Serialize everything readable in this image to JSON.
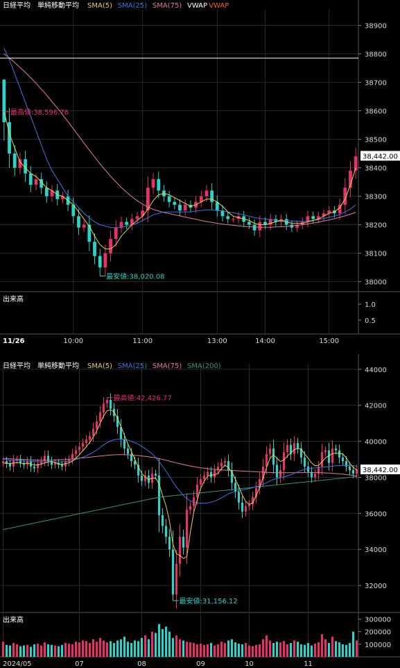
{
  "colors": {
    "background": "#000000",
    "grid": "#2a2a2a",
    "axis_text": "#d8d8d8",
    "up": "#e8306a",
    "down": "#2ad4c8",
    "sma5": "#e8d24a",
    "sma25": "#3a78e0",
    "sma75": "#e87aa0",
    "sma200": "#2a9a70",
    "vwap_white": "#ffffff",
    "vwap_orange": "#f0622a",
    "high_label": "#e8306a",
    "low_label": "#2ad4c8",
    "price_box": "#ffffff"
  },
  "top": {
    "title": "日経平均",
    "legend_label": "単純移動平均",
    "legend": [
      {
        "name": "SMA(5)",
        "color": "#e8d24a"
      },
      {
        "name": "SMA(25)",
        "color": "#3a78e0"
      },
      {
        "name": "SMA(75)",
        "color": "#e87aa0"
      },
      {
        "name": "VWAP",
        "color": "#ffffff"
      },
      {
        "name": "VWAP",
        "color": "#f0622a"
      }
    ],
    "high_label": "最高値:38,596.76",
    "low_label": "最安値:38,020.08",
    "current_price": "38,442.00",
    "volume_title": "出来高",
    "date_label": "11/26"
  },
  "bottom": {
    "title": "日経平均",
    "legend_label": "単純移動平均",
    "legend": [
      {
        "name": "SMA(5)",
        "color": "#e8d24a"
      },
      {
        "name": "SMA(25)",
        "color": "#3a78e0"
      },
      {
        "name": "SMA(75)",
        "color": "#e87aa0"
      },
      {
        "name": "SMA(200)",
        "color": "#2a9a70"
      }
    ],
    "high_label": "最高値:42,426.77",
    "low_label": "最安値:31,156.12",
    "current_price": "38,442.00",
    "volume_title": "出来高"
  },
  "chart_data": [
    {
      "type": "candlestick",
      "title": "日経平均",
      "period": "intraday 5-min",
      "x_ticks": [
        "10:00",
        "11:00",
        "13:00",
        "14:00",
        "15:00"
      ],
      "y_ticks": [
        38000,
        38100,
        38200,
        38300,
        38400,
        38500,
        38600,
        38700,
        38800,
        38900
      ],
      "ylim": [
        37965,
        38955
      ],
      "high": 38596.76,
      "low": 38020.08,
      "last": 38442.0,
      "vwap_level": 38785,
      "closes": [
        38560,
        38450,
        38400,
        38430,
        38380,
        38340,
        38360,
        38330,
        38300,
        38320,
        38290,
        38300,
        38270,
        38230,
        38190,
        38200,
        38140,
        38090,
        38050,
        38100,
        38150,
        38190,
        38210,
        38200,
        38220,
        38230,
        38250,
        38330,
        38360,
        38320,
        38300,
        38280,
        38270,
        38250,
        38270,
        38260,
        38280,
        38300,
        38320,
        38280,
        38250,
        38230,
        38220,
        38220,
        38230,
        38210,
        38200,
        38180,
        38210,
        38200,
        38220,
        38210,
        38220,
        38200,
        38190,
        38200,
        38210,
        38230,
        38220,
        38230,
        38240,
        38250,
        38240,
        38270,
        38330,
        38390,
        38440
      ],
      "sma5": [
        38600,
        38520,
        38470,
        38420,
        38400,
        38380,
        38370,
        38350,
        38330,
        38320,
        38305,
        38300,
        38285,
        38270,
        38245,
        38220,
        38195,
        38160,
        38130,
        38115,
        38115,
        38130,
        38160,
        38180,
        38200,
        38215,
        38230,
        38255,
        38285,
        38305,
        38310,
        38305,
        38295,
        38285,
        38275,
        38265,
        38270,
        38280,
        38290,
        38290,
        38280,
        38265,
        38245,
        38230,
        38225,
        38220,
        38215,
        38205,
        38200,
        38200,
        38205,
        38210,
        38215,
        38210,
        38205,
        38205,
        38205,
        38210,
        38215,
        38220,
        38230,
        38240,
        38245,
        38260,
        38290,
        38340,
        38400
      ],
      "sma25": [
        38820,
        38780,
        38730,
        38680,
        38630,
        38580,
        38530,
        38480,
        38430,
        38390,
        38360,
        38330,
        38300,
        38280,
        38260,
        38240,
        38225,
        38210,
        38200,
        38195,
        38190,
        38190,
        38190,
        38195,
        38200,
        38205,
        38215,
        38225,
        38235,
        38240,
        38245,
        38245,
        38245,
        38245,
        38245,
        38245,
        38248,
        38250,
        38252,
        38252,
        38250,
        38248,
        38245,
        38242,
        38238,
        38235,
        38230,
        38225,
        38222,
        38220,
        38218,
        38216,
        38215,
        38214,
        38213,
        38212,
        38212,
        38213,
        38215,
        38218,
        38222,
        38226,
        38230,
        38236,
        38245,
        38255,
        38270
      ],
      "sma75": [
        38800,
        38785,
        38770,
        38752,
        38735,
        38716,
        38697,
        38676,
        38655,
        38632,
        38610,
        38586,
        38562,
        38537,
        38512,
        38487,
        38462,
        38438,
        38414,
        38392,
        38370,
        38350,
        38331,
        38314,
        38298,
        38284,
        38272,
        38262,
        38254,
        38248,
        38243,
        38239,
        38235,
        38231,
        38227,
        38223,
        38219,
        38215,
        38211,
        38208,
        38205,
        38202,
        38200,
        38198,
        38196,
        38194,
        38193,
        38192,
        38191,
        38191,
        38191,
        38192,
        38193,
        38194,
        38196,
        38198,
        38200,
        38203,
        38206,
        38209,
        38213,
        38217,
        38221,
        38226,
        38231,
        38237,
        38244
      ]
    },
    {
      "type": "candlestick",
      "title": "日経平均",
      "period": "daily",
      "x_ticks": [
        "2024/05",
        "07",
        "08",
        "09",
        "10",
        "11"
      ],
      "y_ticks": [
        32000,
        34000,
        36000,
        38000,
        40000,
        42000,
        44000
      ],
      "ylim": [
        30500,
        44300
      ],
      "high": 42426.77,
      "low": 31156.12,
      "last": 38442.0,
      "volume_ticks": [
        "100000",
        "200000",
        "300000"
      ],
      "closes": [
        38900,
        38750,
        38600,
        38950,
        39000,
        38800,
        38700,
        38900,
        38600,
        38500,
        38750,
        38900,
        39200,
        38900,
        38700,
        38800,
        38700,
        38600,
        38850,
        39000,
        39300,
        39500,
        39700,
        39900,
        40100,
        40300,
        40700,
        41100,
        41600,
        42100,
        42300,
        41800,
        41400,
        40800,
        40100,
        39600,
        39300,
        38900,
        38700,
        38100,
        37800,
        38100,
        37700,
        38200,
        38100,
        35900,
        35300,
        34700,
        34000,
        31500,
        33200,
        34700,
        34100,
        36200,
        36400,
        36900,
        37600,
        37900,
        38100,
        38300,
        38000,
        38400,
        38600,
        38800,
        38900,
        38400,
        37700,
        37200,
        36600,
        36100,
        36400,
        36500,
        36900,
        37400,
        37900,
        38600,
        39300,
        39600,
        38700,
        38000,
        38400,
        39400,
        39800,
        39300,
        39900,
        39600,
        39100,
        38600,
        38300,
        38000,
        38200,
        38600,
        39400,
        39500,
        38800,
        39600,
        39500,
        39100,
        38900,
        38600,
        38400,
        38200,
        38442
      ],
      "sma5": [
        38800,
        38780,
        38760,
        38800,
        38820,
        38790,
        38760,
        38790,
        38740,
        38680,
        38690,
        38730,
        38800,
        38860,
        38880,
        38820,
        38740,
        38720,
        38760,
        38800,
        38900,
        39060,
        39260,
        39480,
        39700,
        39940,
        40240,
        40580,
        41000,
        41420,
        41700,
        41740,
        41640,
        41280,
        40820,
        40340,
        39860,
        39440,
        39000,
        38580,
        38220,
        38020,
        37880,
        37960,
        37960,
        37640,
        37000,
        36420,
        35560,
        34280,
        33760,
        33660,
        33500,
        33600,
        34940,
        36060,
        36740,
        37400,
        37780,
        38080,
        38120,
        38140,
        38220,
        38480,
        38680,
        38540,
        38280,
        37900,
        37480,
        37020,
        36660,
        36500,
        36580,
        36980,
        37440,
        37980,
        38540,
        39060,
        39240,
        39060,
        38880,
        38960,
        39180,
        39360,
        39540,
        39600,
        39560,
        39300,
        39060,
        38800,
        38640,
        38660,
        38860,
        39080,
        39200,
        39320,
        39340,
        39340,
        39300,
        39080,
        38780,
        38560,
        38400
      ],
      "sma25": [
        39000,
        38980,
        38960,
        38940,
        38930,
        38920,
        38910,
        38900,
        38890,
        38880,
        38870,
        38860,
        38860,
        38860,
        38860,
        38860,
        38860,
        38870,
        38880,
        38900,
        38940,
        38990,
        39050,
        39120,
        39200,
        39290,
        39400,
        39520,
        39660,
        39800,
        39920,
        40020,
        40080,
        40120,
        40130,
        40110,
        40070,
        40000,
        39920,
        39840,
        39720,
        39600,
        39460,
        39300,
        39100,
        38880,
        38620,
        38340,
        38060,
        37740,
        37460,
        37220,
        37000,
        36820,
        36700,
        36620,
        36580,
        36560,
        36560,
        36580,
        36620,
        36680,
        36760,
        36860,
        36980,
        37080,
        37160,
        37220,
        37260,
        37300,
        37340,
        37380,
        37420,
        37480,
        37540,
        37620,
        37700,
        37800,
        37880,
        37940,
        37980,
        38020,
        38080,
        38140,
        38220,
        38300,
        38380,
        38440,
        38480,
        38500,
        38520,
        38540,
        38560,
        38580,
        38600,
        38620,
        38640,
        38650,
        38660,
        38660,
        38650,
        38640,
        38630
      ],
      "sma75": [
        39050,
        39040,
        39030,
        39020,
        39010,
        39000,
        38990,
        38980,
        38970,
        38960,
        38950,
        38950,
        38950,
        38950,
        38950,
        38960,
        38970,
        38980,
        38990,
        39000,
        39020,
        39040,
        39060,
        39080,
        39100,
        39120,
        39140,
        39160,
        39180,
        39200,
        39220,
        39240,
        39250,
        39260,
        39260,
        39255,
        39250,
        39240,
        39225,
        39210,
        39190,
        39165,
        39140,
        39110,
        39080,
        39040,
        38995,
        38950,
        38900,
        38850,
        38800,
        38755,
        38710,
        38670,
        38630,
        38595,
        38560,
        38530,
        38505,
        38480,
        38460,
        38440,
        38425,
        38410,
        38400,
        38390,
        38380,
        38370,
        38360,
        38350,
        38340,
        38330,
        38320,
        38310,
        38300,
        38290,
        38280,
        38270,
        38265,
        38260,
        38258,
        38256,
        38256,
        38256,
        38258,
        38260,
        38262,
        38264,
        38266,
        38266,
        38264,
        38260,
        38254,
        38246,
        38236,
        38224,
        38210,
        38194,
        38176,
        38156,
        38134,
        38110,
        38090
      ],
      "sma200": [
        35100,
        35140,
        35180,
        35220,
        35260,
        35300,
        35340,
        35380,
        35420,
        35460,
        35500,
        35540,
        35580,
        35620,
        35660,
        35700,
        35740,
        35780,
        35820,
        35860,
        35900,
        35940,
        35980,
        36020,
        36060,
        36100,
        36140,
        36180,
        36220,
        36260,
        36300,
        36340,
        36380,
        36420,
        36460,
        36500,
        36540,
        36580,
        36620,
        36660,
        36700,
        36740,
        36780,
        36820,
        36860,
        36900,
        36920,
        36940,
        36960,
        36980,
        37000,
        37020,
        37040,
        37060,
        37080,
        37100,
        37120,
        37140,
        37160,
        37180,
        37200,
        37220,
        37240,
        37260,
        37280,
        37300,
        37320,
        37340,
        37360,
        37380,
        37400,
        37420,
        37440,
        37460,
        37480,
        37500,
        37520,
        37540,
        37560,
        37580,
        37600,
        37620,
        37640,
        37660,
        37680,
        37700,
        37720,
        37740,
        37760,
        37780,
        37800,
        37820,
        37840,
        37860,
        37880,
        37900,
        37920,
        37940,
        37960,
        37980,
        38000,
        38020,
        38040
      ],
      "volume": [
        120000,
        95000,
        90000,
        110000,
        100000,
        85000,
        90000,
        95000,
        80000,
        100000,
        105000,
        90000,
        115000,
        100000,
        95000,
        90000,
        85000,
        95000,
        110000,
        105000,
        100000,
        120000,
        115000,
        130000,
        125000,
        110000,
        140000,
        120000,
        150000,
        130000,
        115000,
        125000,
        110000,
        130000,
        140000,
        160000,
        120000,
        110000,
        130000,
        125000,
        150000,
        170000,
        140000,
        200000,
        190000,
        260000,
        220000,
        240000,
        200000,
        150000,
        170000,
        140000,
        130000,
        120000,
        115000,
        110000,
        100000,
        105000,
        95000,
        100000,
        110000,
        90000,
        100000,
        120000,
        110000,
        130000,
        140000,
        115000,
        105000,
        100000,
        110000,
        90000,
        85000,
        95000,
        100000,
        140000,
        170000,
        130000,
        110000,
        120000,
        115000,
        125000,
        100000,
        110000,
        130000,
        120000,
        100000,
        95000,
        110000,
        90000,
        105000,
        115000,
        180000,
        140000,
        110000,
        160000,
        125000,
        115000,
        100000,
        95000,
        110000,
        200000,
        130000
      ]
    }
  ]
}
